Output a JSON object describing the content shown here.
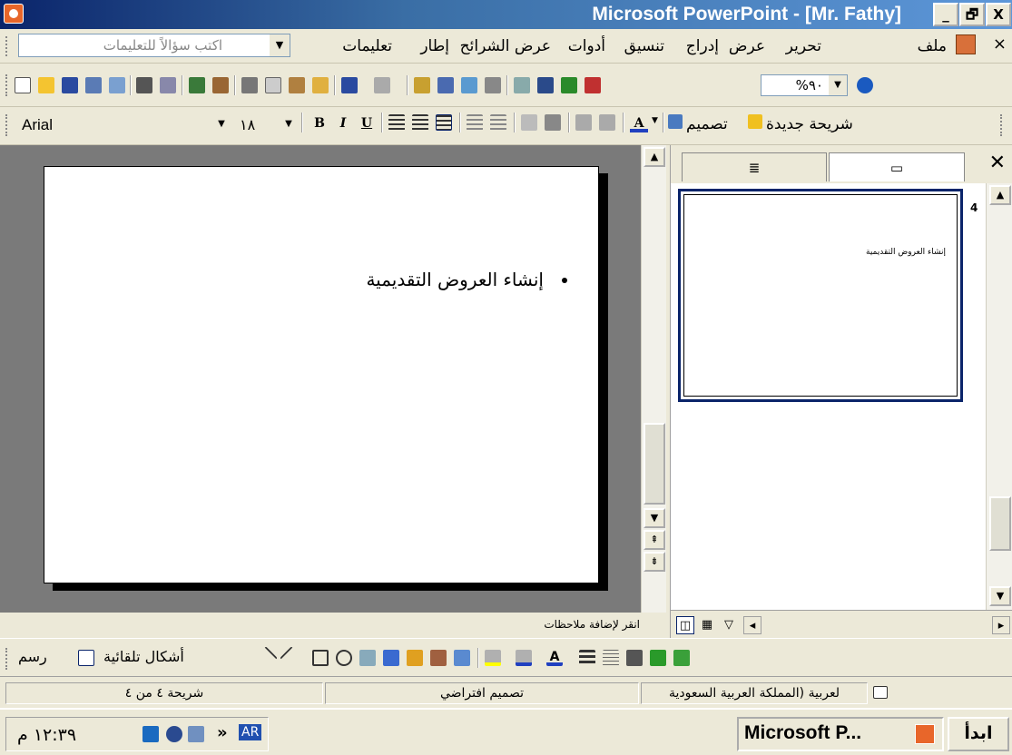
{
  "window": {
    "title": "Microsoft PowerPoint - [Mr. Fathy]",
    "min": "_",
    "max": "🗗",
    "close": "X"
  },
  "menubar": {
    "close_doc": "×",
    "items": [
      "ملف",
      "تحرير",
      "عرض",
      "إدراج",
      "تنسيق",
      "أدوات",
      "عرض الشرائح",
      "إطار",
      "تعليمات"
    ],
    "help_placeholder": "اكتب سؤالاً للتعليمات"
  },
  "standard_toolbar": {
    "zoom": "%٩٠"
  },
  "formatting_toolbar": {
    "font": "Arial",
    "size": "١٨",
    "bold": "B",
    "italic": "I",
    "underline": "U",
    "font_color": "A",
    "design_label": "تصميم",
    "new_slide_label": "شريحة جديدة"
  },
  "slide": {
    "bullet": "إنشاء العروض التقديمية"
  },
  "notes": {
    "placeholder": "انقر لإضافة ملاحظات"
  },
  "panel": {
    "tab_outline_icon": "≣",
    "tab_slides_icon": "▭",
    "close": "✕",
    "thumbnail": {
      "number": "4",
      "text": "إنشاء العروض التقديمية"
    }
  },
  "drawing_toolbar": {
    "draw_label": "رسم",
    "autoshapes_label": "أشكال تلقائية"
  },
  "statusbar": {
    "slide_position": "شريحة ٤ من ٤",
    "design": "تصميم افتراضي",
    "language": "لعربية (المملكة العربية السعودية"
  },
  "taskbar": {
    "time": "١٢:٣٩ م",
    "lang": "AR",
    "task": "Microsoft P...",
    "start": "ابدأ",
    "chevron": "»"
  }
}
